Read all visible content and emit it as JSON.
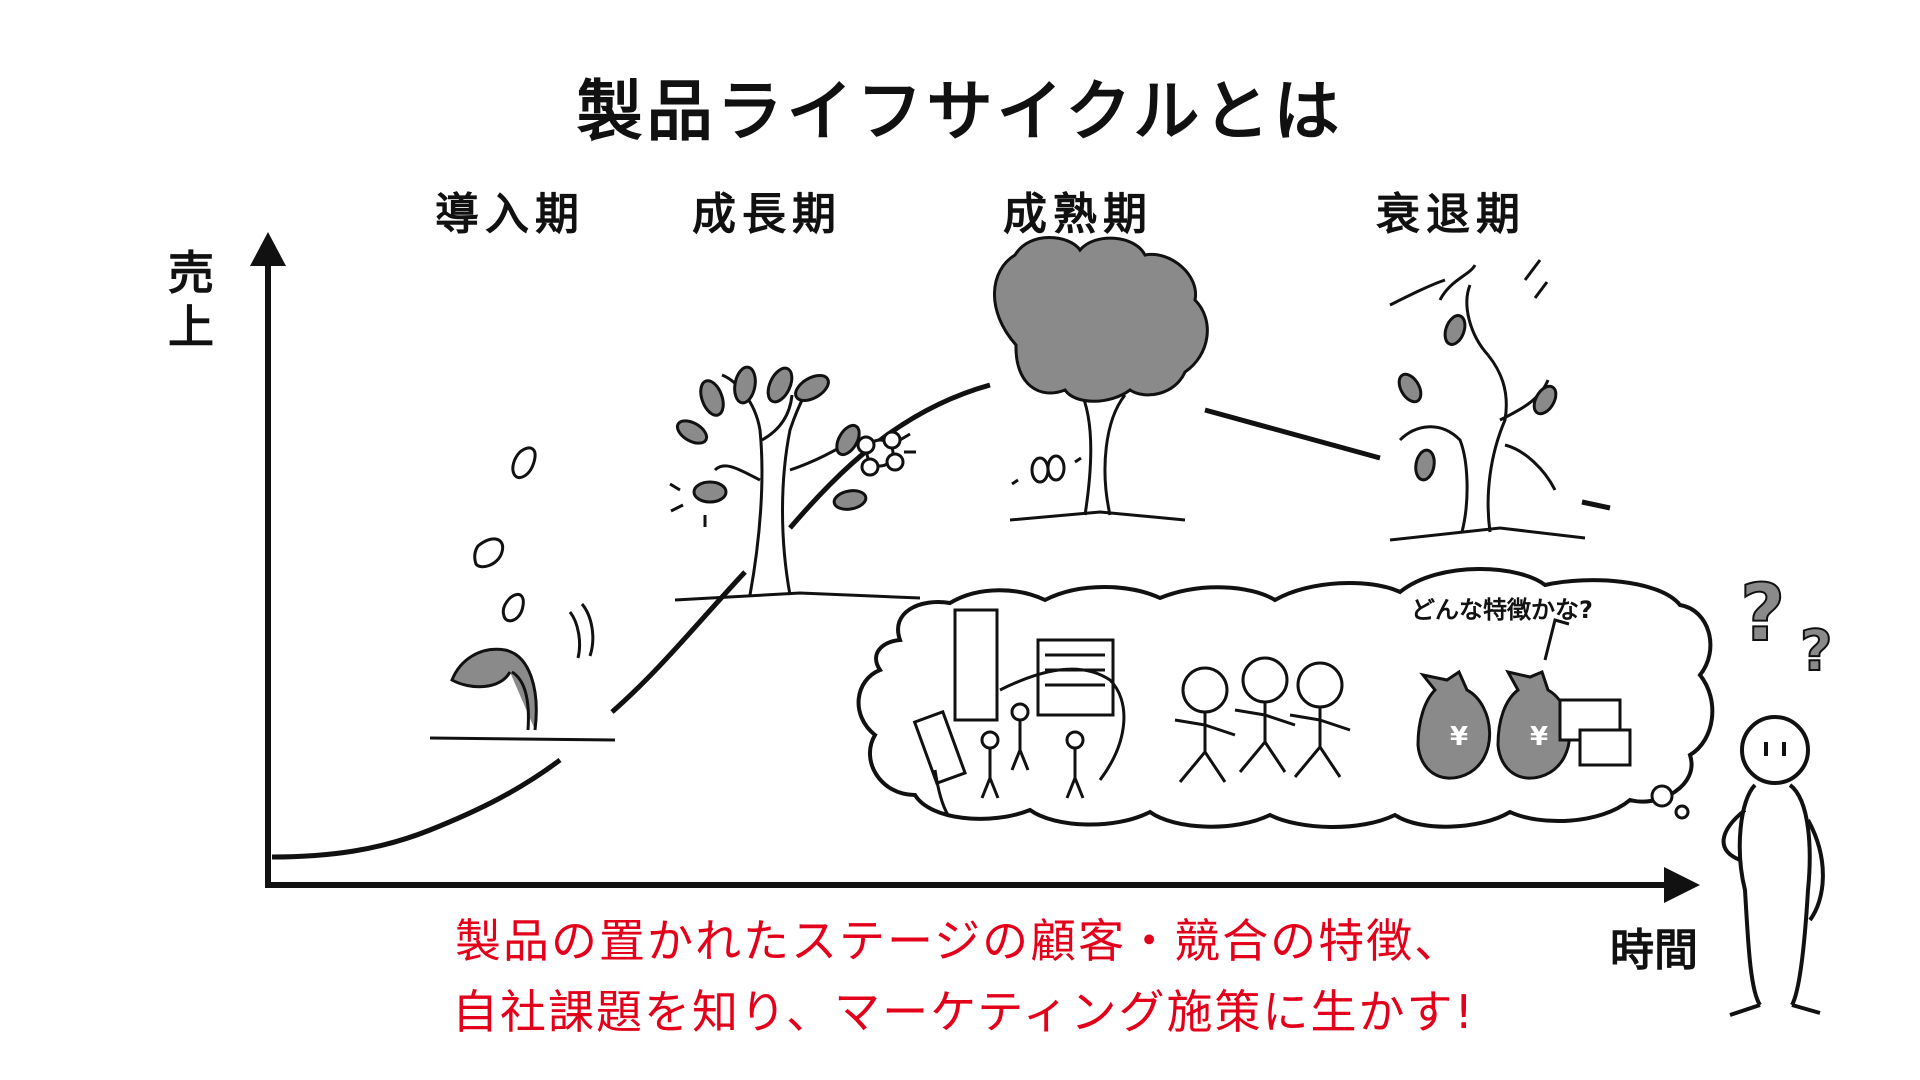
{
  "title": "製品ライフサイクルとは",
  "stages": {
    "intro": "導入期",
    "growth": "成長期",
    "maturity": "成熟期",
    "decline": "衰退期"
  },
  "axes": {
    "y_label": "売上",
    "x_label": "時間"
  },
  "thought_bubble": {
    "text": "どんな特徴かな?",
    "currency_symbol": "¥"
  },
  "message": {
    "line1": "製品の置かれたステージの顧客・競合の特徴、",
    "line2": "自社課題を知り、マーケティング施策に生かす!"
  },
  "colors": {
    "accent_red": "#e3001b",
    "ink": "#111111",
    "tree_gray": "#8a8a8a"
  },
  "icons": [
    "seed-icon",
    "sprout-icon",
    "young-tree-icon",
    "bird-icon",
    "flower-icon",
    "blooming-tree-icon",
    "butterfly-icon",
    "withered-tree-icon",
    "building-icon",
    "person-icon",
    "runner-icon",
    "money-bag-icon",
    "question-mark-icon"
  ]
}
